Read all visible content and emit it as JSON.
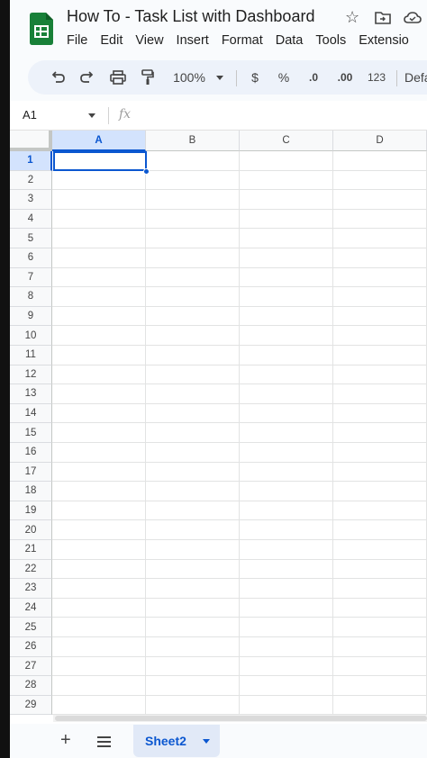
{
  "app": {
    "title": "How To - Task List with Dashboard",
    "accent": "#0b57d0",
    "logo_color": "#188038"
  },
  "menu": [
    "File",
    "Edit",
    "View",
    "Insert",
    "Format",
    "Data",
    "Tools",
    "Extensio"
  ],
  "header_icons": [
    "star-icon",
    "move-to-folder-icon",
    "cloud-status-icon"
  ],
  "toolbar": {
    "zoom": "100%",
    "currency": "$",
    "percent": "%",
    "decrease_decimal": ".0",
    "increase_decimal": ".00",
    "number_format": "123",
    "font": "Defa",
    "icons": [
      "undo-icon",
      "redo-icon",
      "print-icon",
      "paint-format-icon"
    ]
  },
  "formula_bar": {
    "name_box": "A1",
    "fx": "fx",
    "formula": ""
  },
  "grid": {
    "columns": [
      "A",
      "B",
      "C",
      "D"
    ],
    "rows": [
      "1",
      "2",
      "3",
      "4",
      "5",
      "6",
      "7",
      "8",
      "9",
      "10",
      "11",
      "12",
      "13",
      "14",
      "15",
      "16",
      "17",
      "18",
      "19",
      "20",
      "21",
      "22",
      "23",
      "24",
      "25",
      "26",
      "27",
      "28",
      "29"
    ],
    "selected_cell": "A1"
  },
  "sheets": {
    "add": "+",
    "active_tab": "Sheet2"
  }
}
